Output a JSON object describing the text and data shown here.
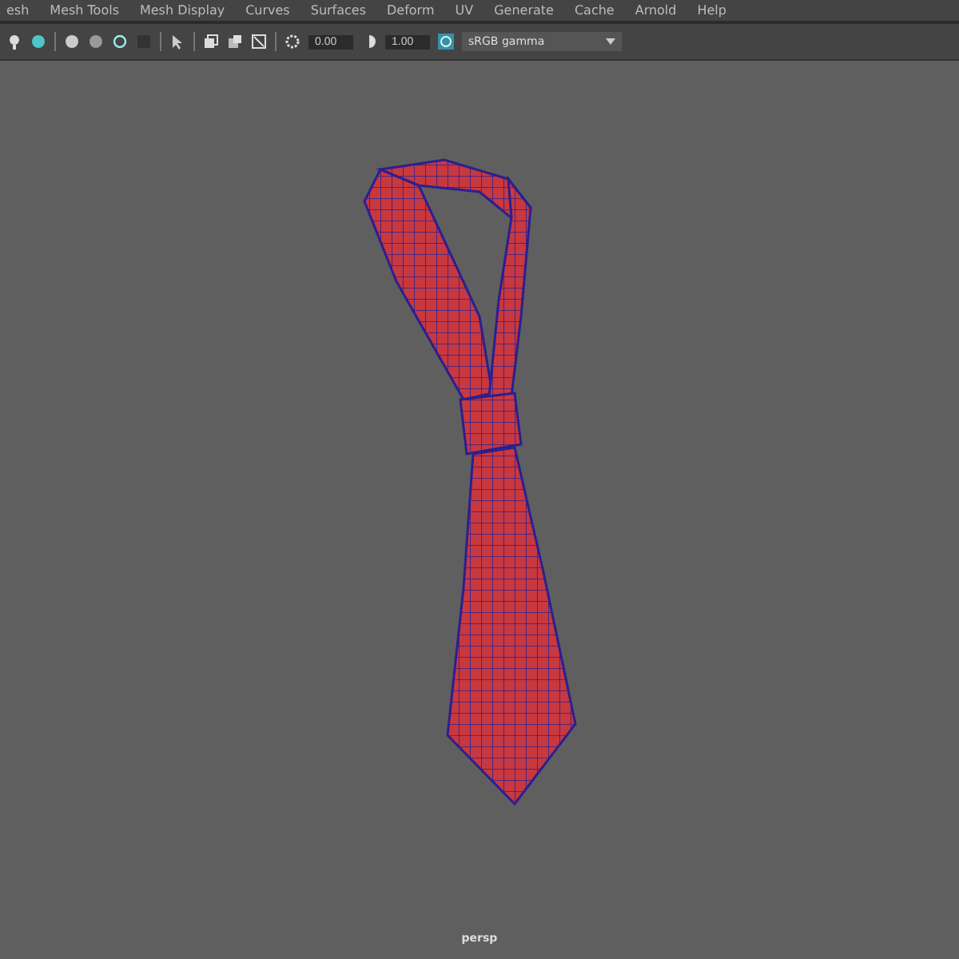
{
  "menu_bar": {
    "items": [
      "esh",
      "Mesh Tools",
      "Mesh Display",
      "Curves",
      "Surfaces",
      "Deform",
      "UV",
      "Generate",
      "Cache",
      "Arnold",
      "Help"
    ]
  },
  "toolbar": {
    "fields": [
      "0.00",
      "1.00"
    ],
    "color_space": "sRGB gamma"
  },
  "viewport": {
    "camera": "persp"
  }
}
